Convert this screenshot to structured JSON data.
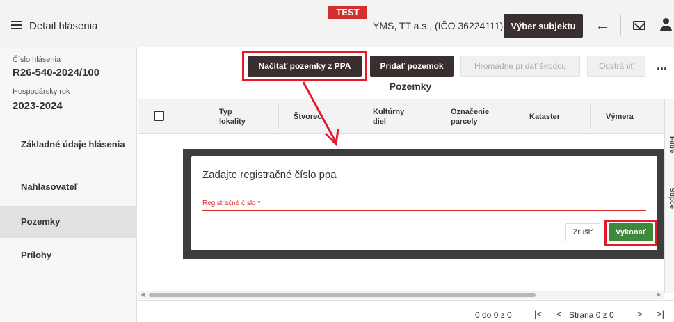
{
  "header": {
    "title": "Detail hlásenia",
    "env_badge": "TEST",
    "subject": "YMS, TT a.s., (IČO 36224111)",
    "choose_subject_label": "Výber subjektu"
  },
  "sidebar": {
    "report_number_label": "Číslo hlásenia",
    "report_number": "R26-540-2024/100",
    "year_label": "Hospodársky rok",
    "year": "2023-2024",
    "nav": [
      {
        "label": "Základné údaje hlásenia",
        "active": false
      },
      {
        "label": "Nahlasovateľ",
        "active": false
      },
      {
        "label": "Pozemky",
        "active": true
      },
      {
        "label": "Prílohy",
        "active": false
      }
    ]
  },
  "toolbar": {
    "load_ppa_label": "Načítať pozemky z PPA",
    "add_land_label": "Pridať pozemok",
    "bulk_damage_label": "Hromadne pridať škodcu",
    "remove_label": "Odstrániť",
    "more_label": "..."
  },
  "section_title": "Pozemky",
  "table": {
    "columns": [
      {
        "label": "Typ\nlokality"
      },
      {
        "label": "Štvorec"
      },
      {
        "label": "Kultúrny\ndiel"
      },
      {
        "label": "Označenie\nparcely"
      },
      {
        "label": "Kataster"
      },
      {
        "label": "Výmera"
      }
    ]
  },
  "side_panel": {
    "filters_label": "Filtre",
    "columns_label": "Stĺpce"
  },
  "dialog": {
    "title": "Zadajte registračné číslo ppa",
    "field_label": "Registračné číslo *",
    "field_value": "",
    "cancel_label": "Zrušiť",
    "submit_label": "Vykonať"
  },
  "pager": {
    "range": "0 do 0 z 0",
    "page_label": "Strana 0 z 0"
  },
  "colors": {
    "accent_dark": "#3a2f2f",
    "highlight_red": "#e8192c",
    "submit_green": "#3d8a3d",
    "test_badge": "#d32f2f"
  }
}
